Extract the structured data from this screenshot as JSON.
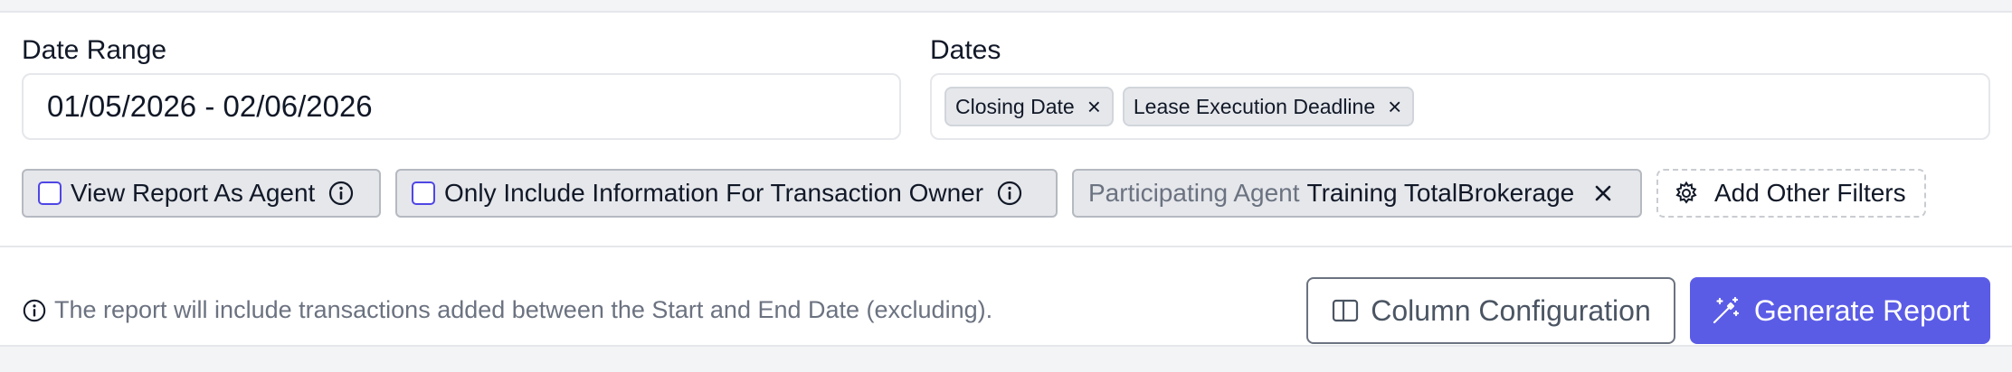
{
  "date_range": {
    "label": "Date Range",
    "value": "01/05/2026 - 02/06/2026"
  },
  "dates": {
    "label": "Dates",
    "chips": [
      {
        "label": "Closing Date",
        "remove": "×"
      },
      {
        "label": "Lease Execution Deadline",
        "remove": "×"
      }
    ]
  },
  "filters": {
    "view_as_agent": "View Report As Agent",
    "owner_only": "Only Include Information For Transaction Owner",
    "participating_agent_key": "Participating Agent",
    "participating_agent_value": "Training TotalBrokerage",
    "add_other": "Add Other Filters"
  },
  "footer": {
    "note": "The report will include transactions added between the Start and End Date (excluding).",
    "column_config": "Column Configuration",
    "generate": "Generate Report"
  },
  "icons": {
    "info": "info-circle-icon",
    "close": "close-icon",
    "gear": "gear-icon",
    "columns": "columns-icon",
    "wand": "magic-wand-icon"
  },
  "colors": {
    "primary": "#5b5ce6",
    "checkbox_border": "#4f46e5",
    "chip_bg": "#e5e7eb",
    "muted_text": "#6b7280"
  }
}
